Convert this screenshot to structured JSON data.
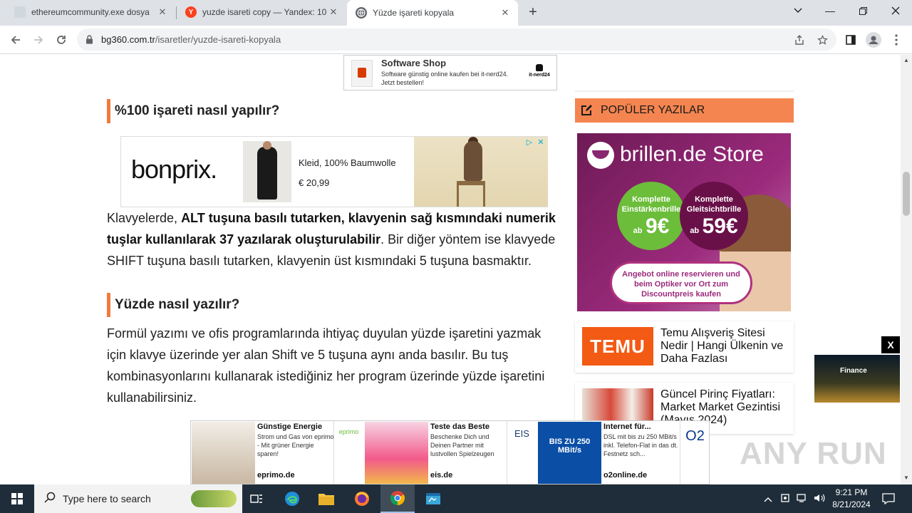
{
  "browser": {
    "tabs": [
      {
        "title": "ethereumcommunity.exe dosya",
        "favicon": "image-icon"
      },
      {
        "title": "yuzde isareti copy — Yandex: 10",
        "favicon": "yandex-icon"
      },
      {
        "title": "Yüzde işareti kopyala",
        "favicon": "globe-icon"
      }
    ],
    "url_host": "bg360.com.tr",
    "url_path": "/isaretler/yuzde-isareti-kopyala"
  },
  "ad_top": {
    "title": "Software Shop",
    "desc": "Software günstig online kaufen bei it-nerd24. Jetzt bestellen!",
    "logo": "it-nerd24"
  },
  "article": {
    "h1": "%100 işareti nasıl yapılır?",
    "ad_bonprix": {
      "brand": "bonprix.",
      "product": "Kleid, 100% Baumwolle",
      "price": "€ 20,99"
    },
    "p1_plain_a": "Klavyelerde, ",
    "p1_bold": "ALT tuşuna basılı tutarken, klavyenin sağ kısmındaki numerik tuşlar kullanılarak 37 yazılarak oluşturulabilir",
    "p1_plain_b": ". Bir diğer yöntem ise klavyede SHIFT tuşuna basılı tutarken, klavyenin üst kısmındaki 5 tuşuna basmaktır.",
    "h2": "Yüzde nasıl yazılır?",
    "p2": "Formül yazımı ve ofis programlarında ihtiyaç duyulan yüzde işaretini yazmak için klavye üzerinde yer alan Shift ve 5 tuşuna aynı anda basılır. Bu tuş kombinasyonlarını kullanarak istediğiniz her program üzerinde yüzde işaretini kullanabilirsiniz."
  },
  "sidebar": {
    "header": "POPÜLER YAZILAR",
    "ad": {
      "title": "brillen.de Store",
      "offer1_line": "Komplette Einstärkenbrille",
      "offer1_price": "9€",
      "offer2_line": "Komplette Gleitsichtbrille",
      "offer2_price": "59€",
      "price_prefix": "ab",
      "cta": "Angebot online reservieren und beim Optiker vor Ort zum Discountpreis kaufen"
    },
    "posts": [
      {
        "title": "Temu Alışveriş Sitesi Nedir | Hangi Ülkenin ve Daha Fazlası",
        "thumb": "TEMU"
      },
      {
        "title": "Güncel Pirinç Fiyatları: Market Market Gezintisi (Mayıs 2024)",
        "thumb": ""
      }
    ]
  },
  "finance_ad": {
    "label": "Finance",
    "close": "X"
  },
  "bottom_ads": [
    {
      "title": "Günstige Energie",
      "desc": "Strom und Gas von eprimo - Mit grüner Energie sparen!",
      "url": "eprimo.de",
      "logo": "eprimo"
    },
    {
      "title": "Teste das Beste",
      "desc": "Beschenke Dich und Deinen Partner mit lustvollen Spielzeugen",
      "url": "eis.de",
      "logo": "EIS"
    },
    {
      "title": "Internet für...",
      "desc": "DSL mit bis zu 250 MBit/s inkl. Telefon-Flat in das dt. Festnetz sch...",
      "url": "o2online.de",
      "logo": "O2",
      "badge": "BIS ZU 250 MBit/s"
    }
  ],
  "watermark": "ANY RUN",
  "taskbar": {
    "search_placeholder": "Type here to search",
    "time": "9:21 PM",
    "date": "8/21/2024"
  }
}
